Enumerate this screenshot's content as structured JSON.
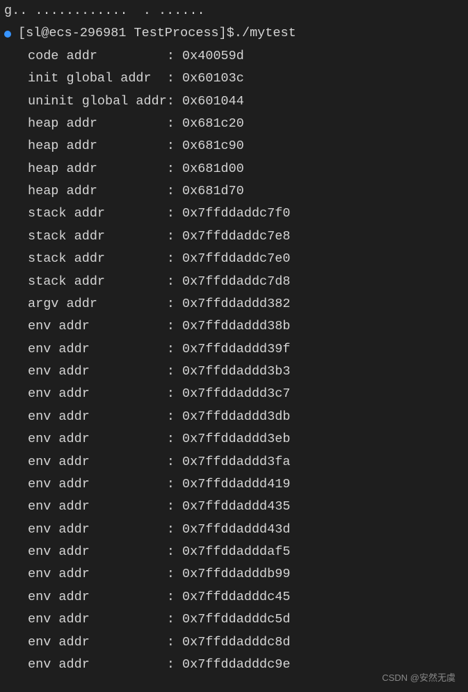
{
  "truncated_line": "g.. ............  . ......",
  "prompt": "[sl@ecs-296981 TestProcess]$ ",
  "command": "./mytest",
  "output": [
    {
      "label": "code addr         ",
      "value": "0x40059d"
    },
    {
      "label": "init global addr  ",
      "value": "0x60103c"
    },
    {
      "label": "uninit global addr",
      "value": "0x601044"
    },
    {
      "label": "heap addr         ",
      "value": "0x681c20"
    },
    {
      "label": "heap addr         ",
      "value": "0x681c90"
    },
    {
      "label": "heap addr         ",
      "value": "0x681d00"
    },
    {
      "label": "heap addr         ",
      "value": "0x681d70"
    },
    {
      "label": "stack addr        ",
      "value": "0x7ffddaddc7f0"
    },
    {
      "label": "stack addr        ",
      "value": "0x7ffddaddc7e8"
    },
    {
      "label": "stack addr        ",
      "value": "0x7ffddaddc7e0"
    },
    {
      "label": "stack addr        ",
      "value": "0x7ffddaddc7d8"
    },
    {
      "label": "argv addr         ",
      "value": "0x7ffddaddd382"
    },
    {
      "label": "env addr          ",
      "value": "0x7ffddaddd38b"
    },
    {
      "label": "env addr          ",
      "value": "0x7ffddaddd39f"
    },
    {
      "label": "env addr          ",
      "value": "0x7ffddaddd3b3"
    },
    {
      "label": "env addr          ",
      "value": "0x7ffddaddd3c7"
    },
    {
      "label": "env addr          ",
      "value": "0x7ffddaddd3db"
    },
    {
      "label": "env addr          ",
      "value": "0x7ffddaddd3eb"
    },
    {
      "label": "env addr          ",
      "value": "0x7ffddaddd3fa"
    },
    {
      "label": "env addr          ",
      "value": "0x7ffddaddd419"
    },
    {
      "label": "env addr          ",
      "value": "0x7ffddaddd435"
    },
    {
      "label": "env addr          ",
      "value": "0x7ffddaddd43d"
    },
    {
      "label": "env addr          ",
      "value": "0x7ffddadddaf5"
    },
    {
      "label": "env addr          ",
      "value": "0x7ffddadddb99"
    },
    {
      "label": "env addr          ",
      "value": "0x7ffddadddc45"
    },
    {
      "label": "env addr          ",
      "value": "0x7ffddadddc5d"
    },
    {
      "label": "env addr          ",
      "value": "0x7ffddadddc8d"
    },
    {
      "label": "env addr          ",
      "value": "0x7ffddadddc9e"
    }
  ],
  "watermark": "CSDN @安然无虞"
}
